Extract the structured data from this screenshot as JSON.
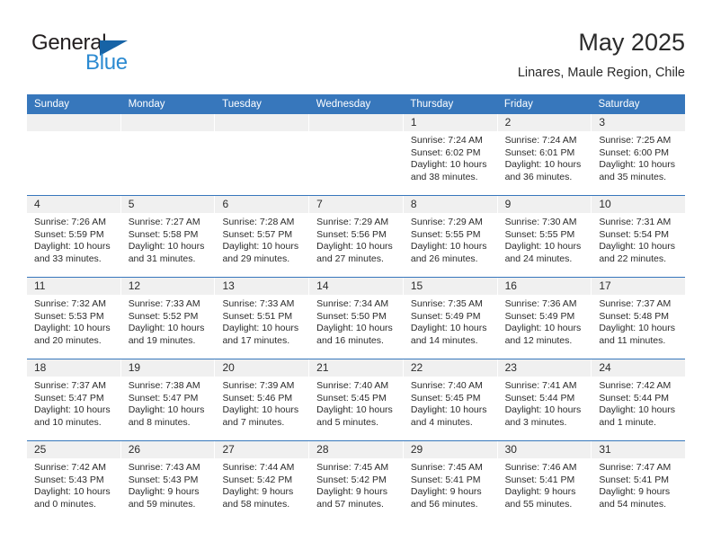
{
  "logo": {
    "word_one": "General",
    "word_two": "Blue",
    "triangle_icon": "triangle-icon",
    "brand_dark": "#231f20",
    "brand_blue": "#2b8ad1",
    "triangle_color": "#1763a6"
  },
  "header": {
    "title": "May 2025",
    "subtitle": "Linares, Maule Region, Chile"
  },
  "theme": {
    "header_bar": "#3777bc",
    "day_head_bg": "#f0f0f0",
    "text": "#2b2b2b"
  },
  "weekdays": [
    "Sunday",
    "Monday",
    "Tuesday",
    "Wednesday",
    "Thursday",
    "Friday",
    "Saturday"
  ],
  "weeks": [
    [
      {
        "date": "",
        "empty": true,
        "sunrise": "",
        "sunset": "",
        "daylight_line1": "",
        "daylight_line2": ""
      },
      {
        "date": "",
        "empty": true,
        "sunrise": "",
        "sunset": "",
        "daylight_line1": "",
        "daylight_line2": ""
      },
      {
        "date": "",
        "empty": true,
        "sunrise": "",
        "sunset": "",
        "daylight_line1": "",
        "daylight_line2": ""
      },
      {
        "date": "",
        "empty": true,
        "sunrise": "",
        "sunset": "",
        "daylight_line1": "",
        "daylight_line2": ""
      },
      {
        "date": "1",
        "sunrise": "Sunrise: 7:24 AM",
        "sunset": "Sunset: 6:02 PM",
        "daylight_line1": "Daylight: 10 hours",
        "daylight_line2": "and 38 minutes."
      },
      {
        "date": "2",
        "sunrise": "Sunrise: 7:24 AM",
        "sunset": "Sunset: 6:01 PM",
        "daylight_line1": "Daylight: 10 hours",
        "daylight_line2": "and 36 minutes."
      },
      {
        "date": "3",
        "sunrise": "Sunrise: 7:25 AM",
        "sunset": "Sunset: 6:00 PM",
        "daylight_line1": "Daylight: 10 hours",
        "daylight_line2": "and 35 minutes."
      }
    ],
    [
      {
        "date": "4",
        "sunrise": "Sunrise: 7:26 AM",
        "sunset": "Sunset: 5:59 PM",
        "daylight_line1": "Daylight: 10 hours",
        "daylight_line2": "and 33 minutes."
      },
      {
        "date": "5",
        "sunrise": "Sunrise: 7:27 AM",
        "sunset": "Sunset: 5:58 PM",
        "daylight_line1": "Daylight: 10 hours",
        "daylight_line2": "and 31 minutes."
      },
      {
        "date": "6",
        "sunrise": "Sunrise: 7:28 AM",
        "sunset": "Sunset: 5:57 PM",
        "daylight_line1": "Daylight: 10 hours",
        "daylight_line2": "and 29 minutes."
      },
      {
        "date": "7",
        "sunrise": "Sunrise: 7:29 AM",
        "sunset": "Sunset: 5:56 PM",
        "daylight_line1": "Daylight: 10 hours",
        "daylight_line2": "and 27 minutes."
      },
      {
        "date": "8",
        "sunrise": "Sunrise: 7:29 AM",
        "sunset": "Sunset: 5:55 PM",
        "daylight_line1": "Daylight: 10 hours",
        "daylight_line2": "and 26 minutes."
      },
      {
        "date": "9",
        "sunrise": "Sunrise: 7:30 AM",
        "sunset": "Sunset: 5:55 PM",
        "daylight_line1": "Daylight: 10 hours",
        "daylight_line2": "and 24 minutes."
      },
      {
        "date": "10",
        "sunrise": "Sunrise: 7:31 AM",
        "sunset": "Sunset: 5:54 PM",
        "daylight_line1": "Daylight: 10 hours",
        "daylight_line2": "and 22 minutes."
      }
    ],
    [
      {
        "date": "11",
        "sunrise": "Sunrise: 7:32 AM",
        "sunset": "Sunset: 5:53 PM",
        "daylight_line1": "Daylight: 10 hours",
        "daylight_line2": "and 20 minutes."
      },
      {
        "date": "12",
        "sunrise": "Sunrise: 7:33 AM",
        "sunset": "Sunset: 5:52 PM",
        "daylight_line1": "Daylight: 10 hours",
        "daylight_line2": "and 19 minutes."
      },
      {
        "date": "13",
        "sunrise": "Sunrise: 7:33 AM",
        "sunset": "Sunset: 5:51 PM",
        "daylight_line1": "Daylight: 10 hours",
        "daylight_line2": "and 17 minutes."
      },
      {
        "date": "14",
        "sunrise": "Sunrise: 7:34 AM",
        "sunset": "Sunset: 5:50 PM",
        "daylight_line1": "Daylight: 10 hours",
        "daylight_line2": "and 16 minutes."
      },
      {
        "date": "15",
        "sunrise": "Sunrise: 7:35 AM",
        "sunset": "Sunset: 5:49 PM",
        "daylight_line1": "Daylight: 10 hours",
        "daylight_line2": "and 14 minutes."
      },
      {
        "date": "16",
        "sunrise": "Sunrise: 7:36 AM",
        "sunset": "Sunset: 5:49 PM",
        "daylight_line1": "Daylight: 10 hours",
        "daylight_line2": "and 12 minutes."
      },
      {
        "date": "17",
        "sunrise": "Sunrise: 7:37 AM",
        "sunset": "Sunset: 5:48 PM",
        "daylight_line1": "Daylight: 10 hours",
        "daylight_line2": "and 11 minutes."
      }
    ],
    [
      {
        "date": "18",
        "sunrise": "Sunrise: 7:37 AM",
        "sunset": "Sunset: 5:47 PM",
        "daylight_line1": "Daylight: 10 hours",
        "daylight_line2": "and 10 minutes."
      },
      {
        "date": "19",
        "sunrise": "Sunrise: 7:38 AM",
        "sunset": "Sunset: 5:47 PM",
        "daylight_line1": "Daylight: 10 hours",
        "daylight_line2": "and 8 minutes."
      },
      {
        "date": "20",
        "sunrise": "Sunrise: 7:39 AM",
        "sunset": "Sunset: 5:46 PM",
        "daylight_line1": "Daylight: 10 hours",
        "daylight_line2": "and 7 minutes."
      },
      {
        "date": "21",
        "sunrise": "Sunrise: 7:40 AM",
        "sunset": "Sunset: 5:45 PM",
        "daylight_line1": "Daylight: 10 hours",
        "daylight_line2": "and 5 minutes."
      },
      {
        "date": "22",
        "sunrise": "Sunrise: 7:40 AM",
        "sunset": "Sunset: 5:45 PM",
        "daylight_line1": "Daylight: 10 hours",
        "daylight_line2": "and 4 minutes."
      },
      {
        "date": "23",
        "sunrise": "Sunrise: 7:41 AM",
        "sunset": "Sunset: 5:44 PM",
        "daylight_line1": "Daylight: 10 hours",
        "daylight_line2": "and 3 minutes."
      },
      {
        "date": "24",
        "sunrise": "Sunrise: 7:42 AM",
        "sunset": "Sunset: 5:44 PM",
        "daylight_line1": "Daylight: 10 hours",
        "daylight_line2": "and 1 minute."
      }
    ],
    [
      {
        "date": "25",
        "sunrise": "Sunrise: 7:42 AM",
        "sunset": "Sunset: 5:43 PM",
        "daylight_line1": "Daylight: 10 hours",
        "daylight_line2": "and 0 minutes."
      },
      {
        "date": "26",
        "sunrise": "Sunrise: 7:43 AM",
        "sunset": "Sunset: 5:43 PM",
        "daylight_line1": "Daylight: 9 hours",
        "daylight_line2": "and 59 minutes."
      },
      {
        "date": "27",
        "sunrise": "Sunrise: 7:44 AM",
        "sunset": "Sunset: 5:42 PM",
        "daylight_line1": "Daylight: 9 hours",
        "daylight_line2": "and 58 minutes."
      },
      {
        "date": "28",
        "sunrise": "Sunrise: 7:45 AM",
        "sunset": "Sunset: 5:42 PM",
        "daylight_line1": "Daylight: 9 hours",
        "daylight_line2": "and 57 minutes."
      },
      {
        "date": "29",
        "sunrise": "Sunrise: 7:45 AM",
        "sunset": "Sunset: 5:41 PM",
        "daylight_line1": "Daylight: 9 hours",
        "daylight_line2": "and 56 minutes."
      },
      {
        "date": "30",
        "sunrise": "Sunrise: 7:46 AM",
        "sunset": "Sunset: 5:41 PM",
        "daylight_line1": "Daylight: 9 hours",
        "daylight_line2": "and 55 minutes."
      },
      {
        "date": "31",
        "sunrise": "Sunrise: 7:47 AM",
        "sunset": "Sunset: 5:41 PM",
        "daylight_line1": "Daylight: 9 hours",
        "daylight_line2": "and 54 minutes."
      }
    ]
  ]
}
